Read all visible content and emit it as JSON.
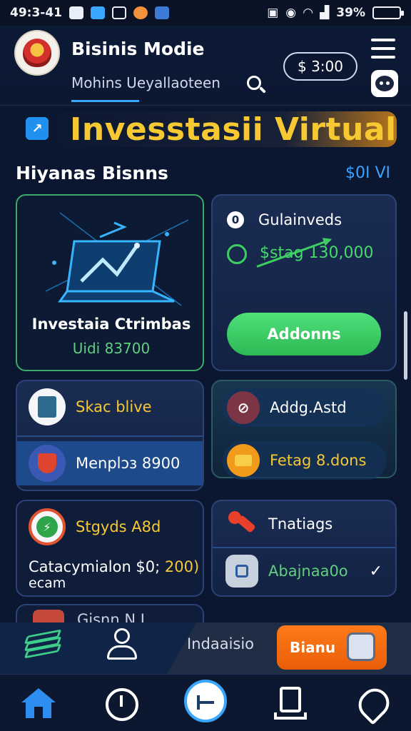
{
  "status_bar": {
    "time": "49:3-41",
    "battery_percent": "39%",
    "battery_level": 0.39
  },
  "header": {
    "app_title": "Bisinis Modie",
    "subnav_label": "Mohins Ueyallaoteen",
    "balance": "$ 3:00"
  },
  "banner": {
    "title": "Invesstasii Virtual"
  },
  "section": {
    "title": "Hiyanas Bisnns",
    "link": "$0I VI"
  },
  "cards": {
    "featured": {
      "title": "Investaia Ctrimbas",
      "subtitle": "Uidi 83700"
    },
    "calculator": {
      "head_label": "Gulainveds",
      "head_icon_glyph": "0",
      "amount": "$stag 130,000",
      "button_label": "Addonns"
    },
    "items_left": [
      {
        "label": "Skac blive",
        "icon": "store-icon",
        "color": "#f6c832"
      },
      {
        "label": "Menplɔɜ 8900",
        "icon": "shield-icon",
        "color": "#ffffff"
      }
    ],
    "items_right": [
      {
        "label": "Addg.Astd",
        "icon": "tag-icon",
        "color": "#ffffff"
      },
      {
        "label": "Fetag 8.dons",
        "icon": "wallet-icon",
        "color": "#f6c832"
      }
    ],
    "stats": {
      "label": "Stgyds A8d",
      "line1_text": "Catacymialon $0;",
      "line1_highlight": "200)",
      "line2": "ecam"
    },
    "tools": {
      "label": "Tnatiags",
      "sub_label": "Abajnaa0o",
      "check": "✓"
    },
    "partial": {
      "label": "Gisnn N.I"
    }
  },
  "action_bar": {
    "label": "Indaaisio",
    "cta_label": "Bianu"
  },
  "colors": {
    "accent": "#3aa7ff",
    "gold": "#f6c832",
    "green": "#3dcf62",
    "orange": "#f26e10",
    "background": "#0b1630"
  }
}
